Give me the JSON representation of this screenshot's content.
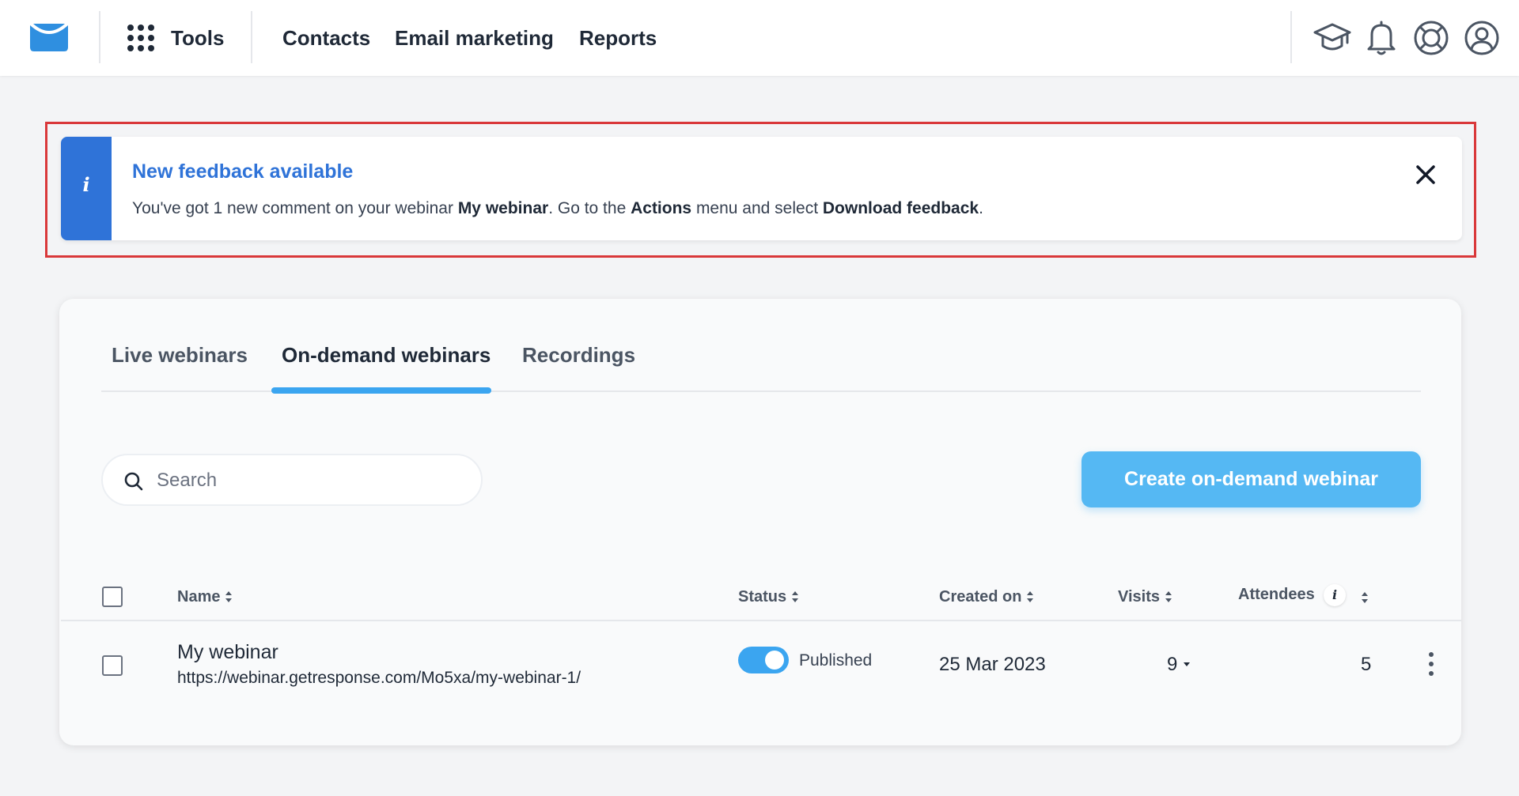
{
  "header": {
    "nav": {
      "tools_label": "Tools",
      "contacts_label": "Contacts",
      "email_marketing_label": "Email marketing",
      "reports_label": "Reports"
    },
    "icons": [
      "envelope-logo-icon",
      "apps-grid-icon",
      "graduation-cap-icon",
      "bell-icon",
      "lifebuoy-icon",
      "user-account-icon"
    ]
  },
  "alert": {
    "title": "New feedback available",
    "message": {
      "part1": "You've got 1 new comment on your webinar ",
      "webinar_name": "My webinar",
      "part2": ". Go to the ",
      "menu_name": "Actions",
      "part3": " menu and select ",
      "action_name": "Download feedback",
      "part4": "."
    },
    "info_symbol": "i"
  },
  "tabs": [
    {
      "label": "Live webinars",
      "active": false
    },
    {
      "label": "On-demand webinars",
      "active": true
    },
    {
      "label": "Recordings",
      "active": false
    }
  ],
  "search": {
    "placeholder": "Search",
    "value": ""
  },
  "create_button_label": "Create on-demand webinar",
  "table": {
    "headers": {
      "name": "Name",
      "status": "Status",
      "created_on": "Created on",
      "visits": "Visits",
      "attendees": "Attendees"
    },
    "attendees_info_symbol": "i",
    "rows": [
      {
        "name": "My webinar",
        "url": "https://webinar.getresponse.com/Mo5xa/my-webinar-1/",
        "status": "Published",
        "published": true,
        "created_on": "25 Mar 2023",
        "visits": "9",
        "attendees": "5"
      }
    ]
  },
  "colors": {
    "brand_blue": "#2f73d8",
    "accent_blue": "#3ba5f0",
    "button_blue": "#55b8f3",
    "highlight_red": "#d9383a"
  }
}
